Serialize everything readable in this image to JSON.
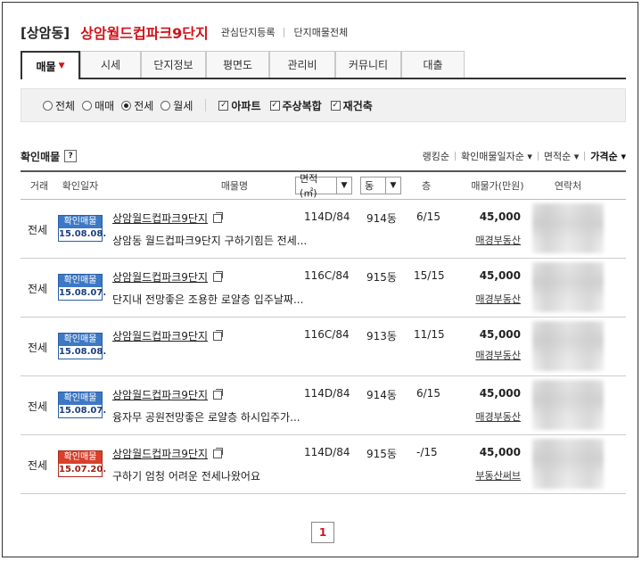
{
  "header": {
    "area": "[상암동]",
    "complex": "상암월드컵파크9단지",
    "link1": "관심단지등록",
    "link2": "단지매물전체"
  },
  "tabs": [
    {
      "label": "매물",
      "active": true
    },
    {
      "label": "시세"
    },
    {
      "label": "단지정보"
    },
    {
      "label": "평면도"
    },
    {
      "label": "관리비"
    },
    {
      "label": "커뮤니티"
    },
    {
      "label": "대출"
    }
  ],
  "filter": {
    "radios": [
      {
        "label": "전체",
        "checked": false
      },
      {
        "label": "매매",
        "checked": false
      },
      {
        "label": "전세",
        "checked": true
      },
      {
        "label": "월세",
        "checked": false
      }
    ],
    "checks": [
      {
        "label": "아파트",
        "checked": true
      },
      {
        "label": "주상복합",
        "checked": true
      },
      {
        "label": "재건축",
        "checked": true
      }
    ]
  },
  "list": {
    "title": "확인매물",
    "help": "?",
    "sorts": [
      "랭킹순",
      "확인매물일자순",
      "면적순",
      "가격순"
    ]
  },
  "columns": {
    "deal": "거래",
    "date": "확인일자",
    "name": "매물명",
    "area": "면적(㎡)",
    "dong": "동",
    "floor": "층",
    "price": "매물가(만원)",
    "contact": "연락처"
  },
  "rows": [
    {
      "deal": "전세",
      "badge_top": "확인매물",
      "badge_date": "15.08.08.",
      "badge_color": "blue",
      "name": "상암월드컵파크9단지",
      "desc": "상암동 월드컵파크9단지 구하기힘든 전세...",
      "area": "114D/84",
      "dong": "914동",
      "floor": "6/15",
      "price": "45,000",
      "agent": "매경부동산"
    },
    {
      "deal": "전세",
      "badge_top": "확인매물",
      "badge_date": "15.08.07.",
      "badge_color": "blue",
      "name": "상암월드컵파크9단지",
      "desc": "단지내 전망좋은 조용한 로얄층 입주날짜...",
      "area": "116C/84",
      "dong": "915동",
      "floor": "15/15",
      "price": "45,000",
      "agent": "매경부동산"
    },
    {
      "deal": "전세",
      "badge_top": "확인매물",
      "badge_date": "15.08.08.",
      "badge_color": "blue",
      "name": "상암월드컵파크9단지",
      "desc": "",
      "area": "116C/84",
      "dong": "913동",
      "floor": "11/15",
      "price": "45,000",
      "agent": "매경부동산"
    },
    {
      "deal": "전세",
      "badge_top": "확인매물",
      "badge_date": "15.08.07.",
      "badge_color": "blue",
      "name": "상암월드컵파크9단지",
      "desc": "융자무 공원전망좋은 로얄층 하시입주가...",
      "area": "114D/84",
      "dong": "914동",
      "floor": "6/15",
      "price": "45,000",
      "agent": "매경부동산"
    },
    {
      "deal": "전세",
      "badge_top": "확인매물",
      "badge_date": "15.07.20.",
      "badge_color": "red",
      "name": "상암월드컵파크9단지",
      "desc": "구하기 엄청 어려운 전세나왔어요",
      "area": "114D/84",
      "dong": "915동",
      "floor": "-/15",
      "price": "45,000",
      "agent": "부동산써브"
    }
  ],
  "pager": {
    "current": "1"
  }
}
